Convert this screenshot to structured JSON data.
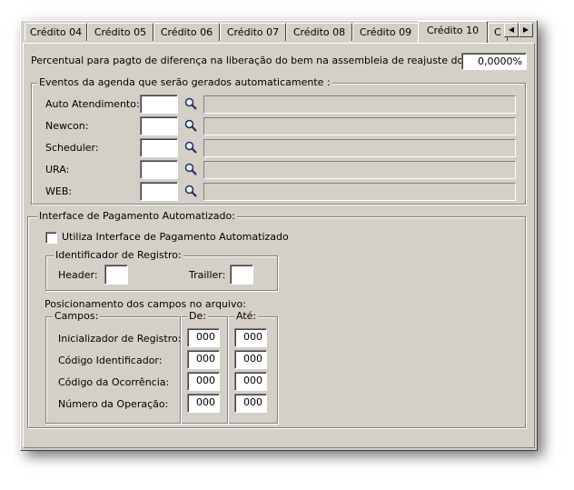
{
  "tabs": [
    "Crédito 04",
    "Crédito 05",
    "Crédito 06",
    "Crédito 07",
    "Crédito 08",
    "Crédito 09",
    "Crédito 10",
    "C"
  ],
  "active_tab": "Crédito 10",
  "tab_scroll": {
    "left": "◀",
    "right": "▶"
  },
  "percentual": {
    "label": "Percentual para pagto de diferença na liberação do bem na assembleia de reajuste do indexador:",
    "value": "0,0000%"
  },
  "eventos": {
    "title": "Eventos da agenda que serão gerados automaticamente :",
    "rows": [
      {
        "label": "Auto Atendimento:",
        "code": "",
        "description": ""
      },
      {
        "label": "Newcon:",
        "code": "",
        "description": ""
      },
      {
        "label": "Scheduler:",
        "code": "",
        "description": ""
      },
      {
        "label": "URA:",
        "code": "",
        "description": ""
      },
      {
        "label": "WEB:",
        "code": "",
        "description": ""
      }
    ],
    "search_icon": "magnifier-icon"
  },
  "interface": {
    "title": "Interface de Pagamento Automatizado:",
    "checkbox_label": "Utiliza Interface de Pagamento Automatizado",
    "checkbox_checked": false,
    "identificador": {
      "title": "Identificador de Registro:",
      "header_label": "Header:",
      "header_value": "",
      "trailer_label": "Trailler:",
      "trailer_value": ""
    },
    "posicionamento_label": "Posicionamento dos campos no arquivo:",
    "campos_title": "Campos:",
    "de_title": "De:",
    "ate_title": "Até:",
    "campos": [
      {
        "label": "Inicializador de Registro:",
        "de": "000",
        "ate": "000"
      },
      {
        "label": "Código Identificador:",
        "de": "000",
        "ate": "000"
      },
      {
        "label": "Código da Ocorrência:",
        "de": "000",
        "ate": "000"
      },
      {
        "label": "Número da Operação:",
        "de": "000",
        "ate": "000"
      }
    ]
  }
}
